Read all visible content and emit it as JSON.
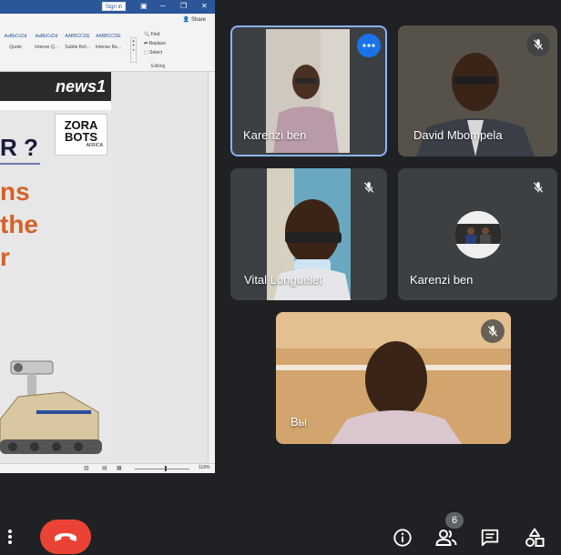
{
  "word": {
    "signin_label": "Sign in",
    "share_label": "Share",
    "styles": [
      {
        "sample": "AaBbCcDd",
        "name": "Quote"
      },
      {
        "sample": "AaBbCcDd",
        "name": "Intense Q..."
      },
      {
        "sample": "AABBCCDE",
        "name": "Subtle Ref..."
      },
      {
        "sample": "AABBCCDE",
        "name": "Intense Re..."
      }
    ],
    "find_label": "Find",
    "replace_label": "Replace",
    "select_label": "Select",
    "editing_group": "Editing",
    "zoom_level": "118%",
    "slide": {
      "news_logo": "news1",
      "title_fragment": "R ?",
      "orange_lines": [
        "ns",
        "the",
        "r"
      ],
      "logo_main": "ZORA BOTS",
      "logo_sub": "AFRICA"
    }
  },
  "participants": [
    {
      "name": "Karenzi ben",
      "muted": false,
      "active": true
    },
    {
      "name": "David Mbompela",
      "muted": true,
      "active": false
    },
    {
      "name": "Vital Longuelet",
      "muted": true,
      "active": false
    },
    {
      "name": "Karenzi ben",
      "muted": true,
      "active": false
    },
    {
      "name": "Вы",
      "muted": true,
      "active": false
    }
  ],
  "controls": {
    "people_count": "6"
  },
  "colors": {
    "background": "#202124",
    "tile": "#3c4043",
    "end_call": "#ea4335",
    "active_border": "#8ab4f8",
    "more_button": "#1a73e8",
    "word_blue": "#2b579a",
    "slide_orange": "#d2622a"
  },
  "icons": {
    "mic_off": "mic-off-icon",
    "more": "more-options-icon",
    "end_call": "call-end-icon",
    "info": "info-icon",
    "people": "people-icon",
    "chat": "chat-icon",
    "activities": "activities-icon"
  }
}
